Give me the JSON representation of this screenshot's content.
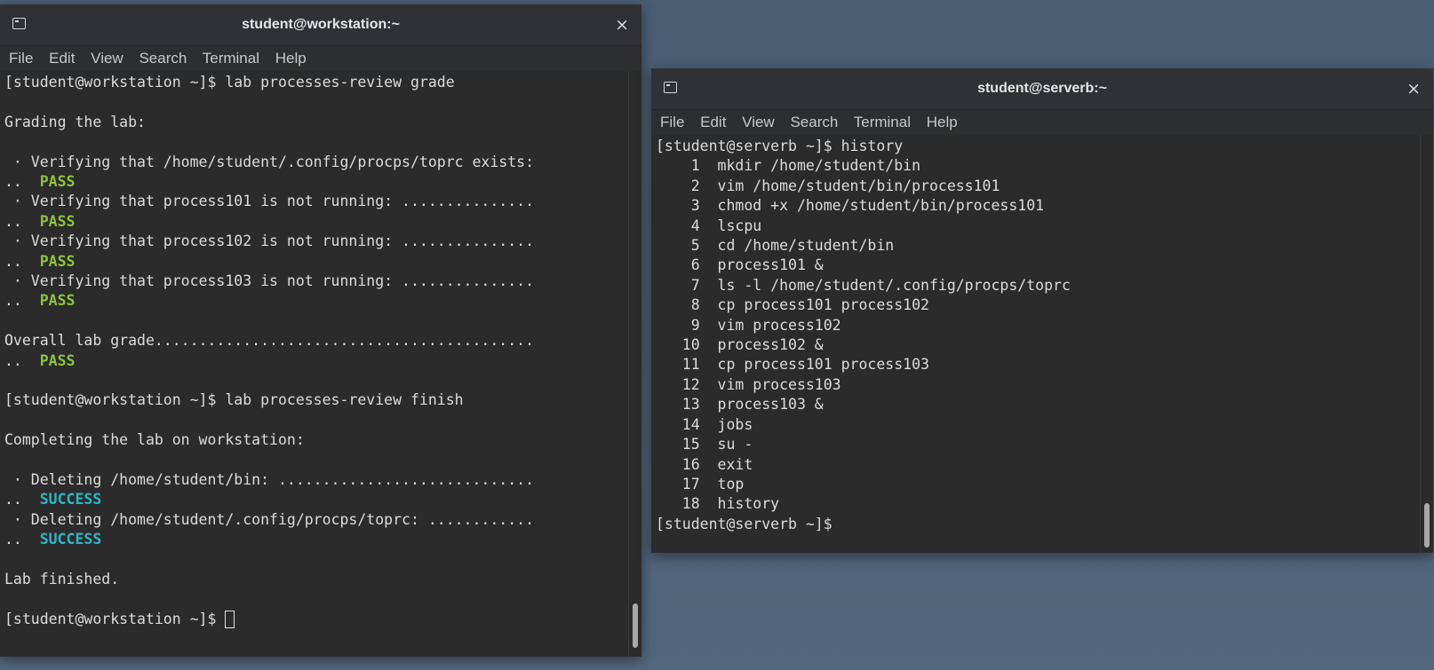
{
  "workstation": {
    "title": "student@workstation:~",
    "close": "×",
    "menu": [
      "File",
      "Edit",
      "View",
      "Search",
      "Terminal",
      "Help"
    ],
    "lines": [
      {
        "text": "[student@workstation ~]$ lab processes-review grade"
      },
      {
        "text": ""
      },
      {
        "text": "Grading the lab:"
      },
      {
        "text": ""
      },
      {
        "text": " · Verifying that /home/student/.config/procps/toprc exists:"
      },
      {
        "text": "..  ",
        "status": "PASS",
        "kind": "pass"
      },
      {
        "text": " · Verifying that process101 is not running: ..............."
      },
      {
        "text": "..  ",
        "status": "PASS",
        "kind": "pass"
      },
      {
        "text": " · Verifying that process102 is not running: ..............."
      },
      {
        "text": "..  ",
        "status": "PASS",
        "kind": "pass"
      },
      {
        "text": " · Verifying that process103 is not running: ..............."
      },
      {
        "text": "..  ",
        "status": "PASS",
        "kind": "pass"
      },
      {
        "text": ""
      },
      {
        "text": "Overall lab grade..........................................."
      },
      {
        "text": "..  ",
        "status": "PASS",
        "kind": "pass"
      },
      {
        "text": ""
      },
      {
        "text": "[student@workstation ~]$ lab processes-review finish"
      },
      {
        "text": ""
      },
      {
        "text": "Completing the lab on workstation:"
      },
      {
        "text": ""
      },
      {
        "text": " · Deleting /home/student/bin: ............................."
      },
      {
        "text": "..  ",
        "status": "SUCCESS",
        "kind": "success"
      },
      {
        "text": " · Deleting /home/student/.config/procps/toprc: ............"
      },
      {
        "text": "..  ",
        "status": "SUCCESS",
        "kind": "success"
      },
      {
        "text": ""
      },
      {
        "text": "Lab finished."
      },
      {
        "text": ""
      },
      {
        "text": "[student@workstation ~]$ ",
        "cursor": true
      }
    ]
  },
  "serverb": {
    "title": "student@serverb:~",
    "close": "×",
    "menu": [
      "File",
      "Edit",
      "View",
      "Search",
      "Terminal",
      "Help"
    ],
    "lines": [
      {
        "text": "[student@serverb ~]$ history"
      },
      {
        "text": "    1  mkdir /home/student/bin"
      },
      {
        "text": "    2  vim /home/student/bin/process101"
      },
      {
        "text": "    3  chmod +x /home/student/bin/process101"
      },
      {
        "text": "    4  lscpu"
      },
      {
        "text": "    5  cd /home/student/bin"
      },
      {
        "text": "    6  process101 &"
      },
      {
        "text": "    7  ls -l /home/student/.config/procps/toprc"
      },
      {
        "text": "    8  cp process101 process102"
      },
      {
        "text": "    9  vim process102"
      },
      {
        "text": "   10  process102 &"
      },
      {
        "text": "   11  cp process101 process103"
      },
      {
        "text": "   12  vim process103"
      },
      {
        "text": "   13  process103 &"
      },
      {
        "text": "   14  jobs"
      },
      {
        "text": "   15  su -"
      },
      {
        "text": "   16  exit"
      },
      {
        "text": "   17  top"
      },
      {
        "text": "   18  history"
      },
      {
        "text": "[student@serverb ~]$"
      }
    ]
  }
}
